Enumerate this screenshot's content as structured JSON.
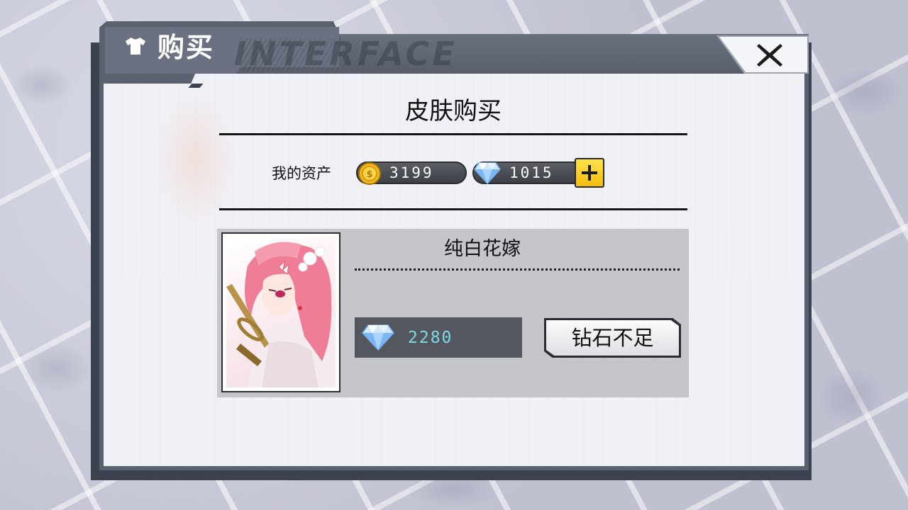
{
  "header": {
    "title": "购买",
    "watermark": "INTERFACE",
    "icon": "shirt-icon",
    "close_icon": "close-icon"
  },
  "dialog": {
    "section_title": "皮肤购买",
    "assets": {
      "label": "我的资产",
      "coins": "3199",
      "diamonds": "1015",
      "coin_icon": "coin-icon",
      "diamond_icon": "diamond-icon",
      "add_icon": "plus-icon"
    },
    "item": {
      "name": "纯白花嫁",
      "price": "2280",
      "currency_icon": "diamond-icon",
      "button_label": "钻石不足"
    }
  },
  "colors": {
    "header": "#5b616f",
    "price_text": "#7fd8e6",
    "add_button": "#f8cf1e",
    "hair": "#f07d97"
  }
}
